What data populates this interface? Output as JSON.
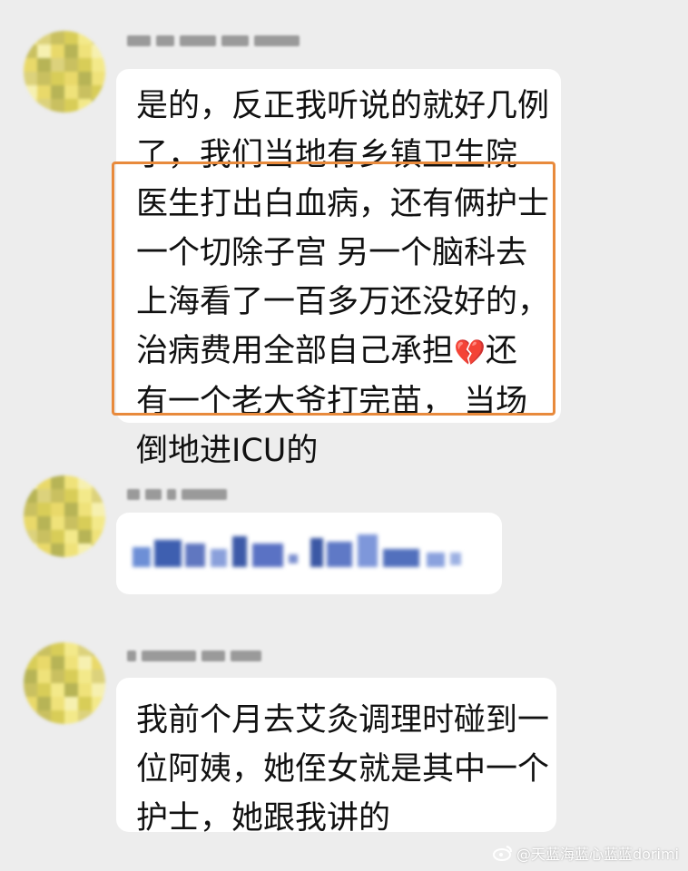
{
  "colors": {
    "background": "#ededed",
    "bubble": "#ffffff",
    "highlight_border": "#e88a3c",
    "heart": "#e0263a"
  },
  "messages": [
    {
      "lines_before": [
        "是的，反正我听说的就好几例",
        "了，我们当地有乡镇卫生院"
      ],
      "highlighted_lines": [
        "医生打出白血病，还有俩护士",
        "一个切除子宫 另一个脑科去",
        "上海看了一百多万还没好的，",
        "治病费用全部自己承担",
        "有一个老大爷打完苗， 当场",
        "倒地进ICU的"
      ],
      "emoji_after_line_4": "💔",
      "line_4_tail": "还"
    },
    {
      "blurred_content": true
    },
    {
      "lines": [
        "我前个月去艾灸调理时碰到一",
        "位阿姨，她侄女就是其中一个",
        "护士，她跟我讲的"
      ]
    }
  ],
  "watermark": {
    "icon": "weibo-icon",
    "text": "@天蓝海蓝心蓝蓝dorimi"
  }
}
